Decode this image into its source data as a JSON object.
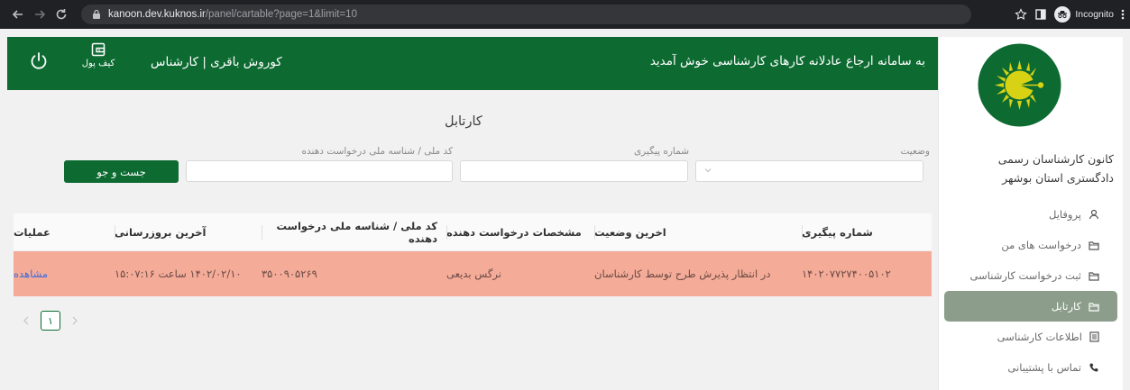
{
  "browser": {
    "url_host": "kanoon.dev.kuknos.ir",
    "url_path": "/panel/cartable?page=1&limit=10",
    "incognito_label": "Incognito"
  },
  "header": {
    "welcome": "به سامانه ارجاع عادلانه کارهای کارشناسی خوش آمدید",
    "user": "کوروش باقری | کارشناس",
    "wallet_label": "کیف پول"
  },
  "sidebar": {
    "org_name_line1": "کانون کارشناسان رسمی",
    "org_name_line2": "دادگستری استان بوشهر",
    "items": [
      {
        "label": "پروفایل",
        "icon": "user-icon"
      },
      {
        "label": "درخواست های من",
        "icon": "folder-icon"
      },
      {
        "label": "ثبت درخواست کارشناسی",
        "icon": "folder-icon"
      },
      {
        "label": "کارتابل",
        "icon": "folder-icon",
        "active": true
      },
      {
        "label": "اطلاعات کارشناسی",
        "icon": "list-icon"
      },
      {
        "label": "تماس با پشتیبانی",
        "icon": "phone-icon"
      }
    ]
  },
  "main": {
    "title": "کارتابل",
    "filters": {
      "status_label": "وضعیت",
      "tracking_label": "شماره پیگیری",
      "national_id_label": "کد ملی / شناسه ملی درخواست دهنده",
      "search_button": "جست و جو"
    },
    "table": {
      "columns": [
        "شماره پیگیری",
        "اخرین وضعیت",
        "مشخصات درخواست دهنده",
        "کد ملی / شناسه ملی درخواست دهنده",
        "آخرین بروزرسانی",
        "عملیات"
      ],
      "rows": [
        {
          "tracking": "۱۴۰۲۰۷۷۲۷۴۰۰۵۱۰۲",
          "status": "در انتظار پذیرش طرح توسط کارشناسان",
          "requester": "نرگس بدیعی",
          "national_id": "۳۵۰۰۹۰۵۲۶۹",
          "updated": "۱۴۰۲/۰۲/۱۰ ساعت ۱۵:۰۷:۱۶",
          "action": "مشاهده"
        }
      ]
    },
    "pagination": {
      "current": "۱"
    }
  },
  "colors": {
    "brand_green": "#0d6b32",
    "active_menu": "#8c9e8b",
    "row_highlight": "#f4ab98",
    "link": "#3d6bd8"
  }
}
